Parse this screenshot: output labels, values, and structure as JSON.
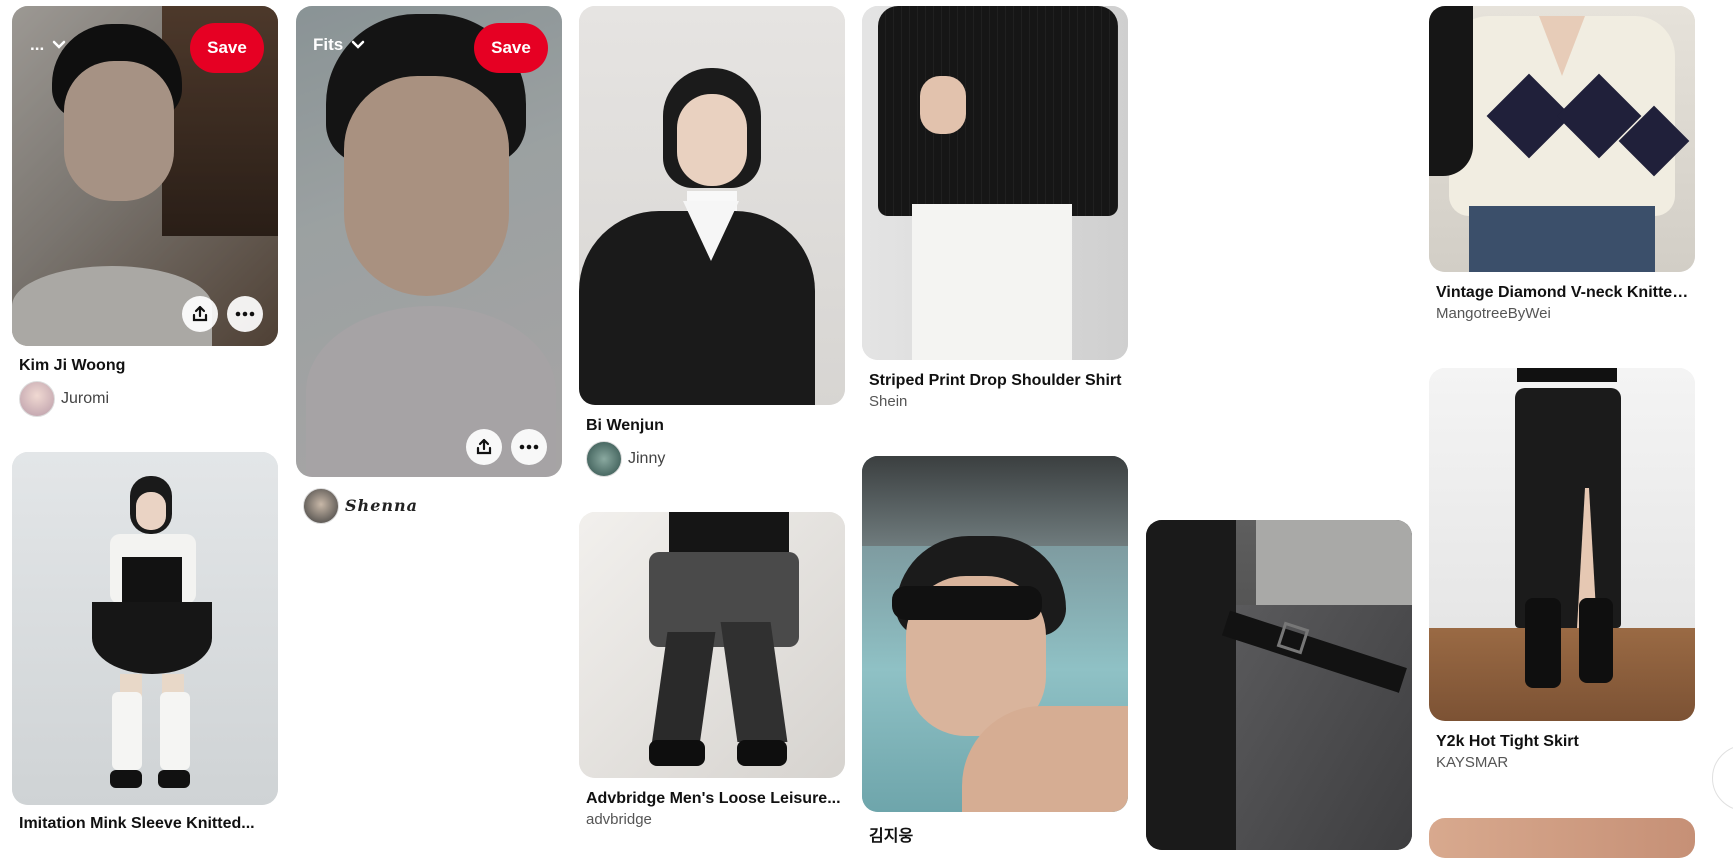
{
  "pins": [
    {
      "id": "kim",
      "title": "Kim Ji Woong",
      "creator": "Juromi",
      "board_label": "...",
      "save_label": "Save"
    },
    {
      "id": "fits",
      "creator": "Shenna",
      "board_label": "Fits",
      "save_label": "Save"
    },
    {
      "id": "bi",
      "title": "Bi Wenjun",
      "creator": "Jinny"
    },
    {
      "id": "striped",
      "title": "Striped Print Drop Shoulder Shirt",
      "source": "Shein"
    },
    {
      "id": "vintage",
      "title": "Vintage Diamond V-neck Knitted...",
      "source": "MangotreeByWei"
    },
    {
      "id": "imitation",
      "title": "Imitation Mink Sleeve Knitted..."
    },
    {
      "id": "advbridge",
      "title": "Advbridge Men's Loose Leisure...",
      "source": "advbridge"
    },
    {
      "id": "pool",
      "title": "김지웅"
    },
    {
      "id": "trousers"
    },
    {
      "id": "skirt",
      "title": "Y2k Hot Tight Skirt",
      "source": "KAYSMAR"
    }
  ],
  "icons": {
    "share": "share-icon",
    "more": "more-options-icon",
    "chevron": "chevron-down-icon"
  },
  "colors": {
    "save": "#e60023"
  }
}
